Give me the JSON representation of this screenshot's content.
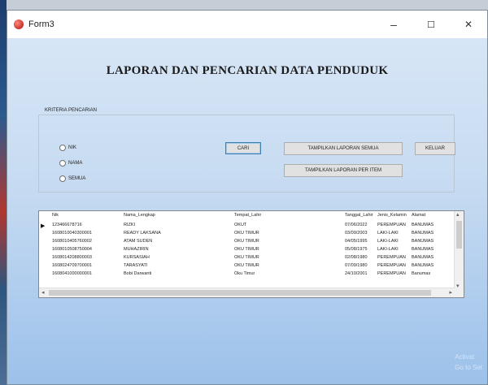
{
  "window": {
    "title": "Form3",
    "minimize": "–",
    "maximize": "☐",
    "close": "✕"
  },
  "heading": "LAPORAN DAN PENCARIAN DATA PENDUDUK",
  "search": {
    "group_label": "KRITERIA PENCARIAN",
    "radios": [
      "NIK",
      "NAMA",
      "SEMUA"
    ]
  },
  "buttons": {
    "cari": "CARI",
    "tampilkan_semua": "TAMPILKAN LAPORAN SEMUA",
    "tampilkan_perorang": "TAMPILKAN LAPORAN PER ITEM",
    "keluar": "KELUAR"
  },
  "table": {
    "columns": [
      "Nik",
      "Nama_Lengkap",
      "Tempat_Lahir",
      "Tanggal_Lahir",
      "Jenis_Kelamin",
      "Alamat"
    ],
    "rows": [
      [
        "123466678716",
        "RIZKI",
        "OKUT",
        "07/06/2022",
        "PEREMPUAN",
        "BANUMAS"
      ],
      [
        "1608010040300001",
        "READY LAKSANA",
        "OKU TIMUR",
        "03/09/2003",
        "LAKI-LAKI",
        "BANUMAS"
      ],
      [
        "1608010405760002",
        "ATAM SUDEN",
        "OKU TIMUR",
        "04/05/1995",
        "LAKI-LAKI",
        "BANUMAS"
      ],
      [
        "1608010508750004",
        "MUHAZIRIN",
        "OKU TIMUR",
        "05/08/1975",
        "LAKI-LAKI",
        "BANUMAS"
      ],
      [
        "1608014208800003",
        "KURSASIAH",
        "OKU TIMUR",
        "02/08/1980",
        "PEREMPUAN",
        "BANUMAS"
      ],
      [
        "1608024709700001",
        "TARASYATI",
        "OKU TIMUR",
        "07/09/1980",
        "PEREMPUAN",
        "BANUMAS"
      ],
      [
        "1608041000000001",
        "Bobi Darwanti",
        "Oku Timur",
        "24/10/2001",
        "PEREMPUAN",
        "Banumas"
      ]
    ],
    "selected_row_marker": "▶"
  },
  "watermark": {
    "line1": "Activat",
    "line2": "Go to Set"
  }
}
